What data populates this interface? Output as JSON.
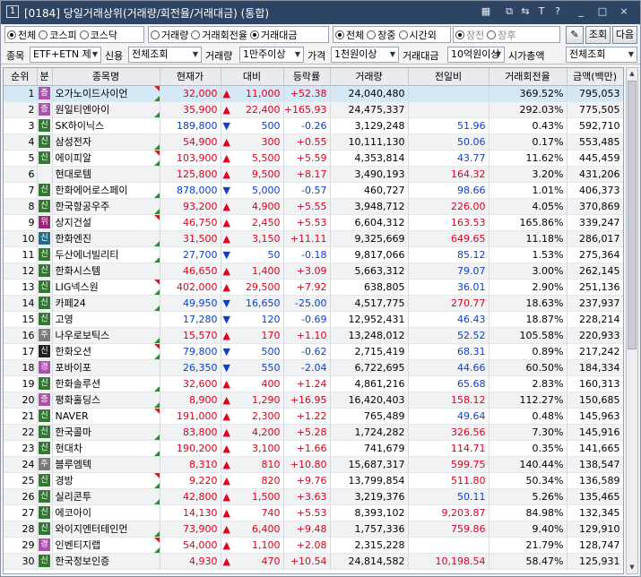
{
  "window": {
    "screen_no": "1",
    "title": "[0184] 당일거래상위(거래량/회전율/거래대금) (통합)",
    "title_icons": [
      "grid-icon",
      "copy-icon",
      "link-icon",
      "font-icon",
      "help-icon",
      "minimize-icon",
      "maximize-icon",
      "close-icon"
    ],
    "title_glyphs": [
      "▦",
      "⧉",
      "⇆",
      "T",
      "?",
      "_",
      "□",
      "×"
    ]
  },
  "filters": {
    "market": {
      "options": [
        "전체",
        "코스피",
        "코스닥"
      ],
      "selected": "전체"
    },
    "sort": {
      "options": [
        "거래량",
        "거래회전율",
        "거래대금"
      ],
      "selected": "거래대금"
    },
    "session": {
      "options": [
        "전체",
        "장중",
        "시간외"
      ],
      "selected": "전체"
    },
    "after_hours": {
      "options": [
        "장전",
        "장후"
      ],
      "selected": "장전"
    },
    "search_label": "조회",
    "next_label": "다음",
    "stock_label": "종목",
    "stock_value": "ETF+ETN 제",
    "credit_label": "신용",
    "credit_value": "전체조회",
    "volume_label": "거래량",
    "volume_value": "1만주이상",
    "price_label": "가격",
    "price_value": "1천원이상",
    "amount_label": "거래대금",
    "amount_value": "10억원이상",
    "mcap_label": "시가총액",
    "mcap_value": "전체조회"
  },
  "table": {
    "headers": [
      "순위",
      "분",
      "종목명",
      "현재가",
      "대비",
      "등락률",
      "거래량",
      "전일비",
      "거래회전율",
      "금액(백만)"
    ],
    "rows": [
      {
        "rank": "1",
        "badge": "증",
        "badge_color": "#b04fb0",
        "name": "오가노이드사이언",
        "price": "32,000",
        "dir": "up",
        "change": "11,000",
        "rate": "+52.38",
        "volume": "24,040,480",
        "prev": "",
        "turnover": "369.52%",
        "amount": "795,053"
      },
      {
        "rank": "2",
        "badge": "증",
        "badge_color": "#b04fb0",
        "name": "원일티엔아이",
        "price": "35,900",
        "dir": "up",
        "change": "22,400",
        "rate": "+165.93",
        "volume": "24,475,337",
        "prev": "",
        "turnover": "292.03%",
        "amount": "775,505"
      },
      {
        "rank": "3",
        "badge": "신",
        "badge_color": "#2f7a2f",
        "name": "SK하이닉스",
        "price": "189,800",
        "dir": "dn",
        "change": "500",
        "rate": "-0.26",
        "volume": "3,129,248",
        "prev": "51.96",
        "turnover": "0.43%",
        "amount": "592,710"
      },
      {
        "rank": "4",
        "badge": "신",
        "badge_color": "#2f7a2f",
        "name": "삼성전자",
        "price": "54,900",
        "dir": "up",
        "change": "300",
        "rate": "+0.55",
        "volume": "10,111,130",
        "prev": "50.06",
        "turnover": "0.17%",
        "amount": "553,485"
      },
      {
        "rank": "5",
        "badge": "신",
        "badge_color": "#2f7a2f",
        "name": "에이피알",
        "price": "103,900",
        "dir": "up",
        "change": "5,500",
        "rate": "+5.59",
        "volume": "4,353,814",
        "prev": "43.77",
        "turnover": "11.62%",
        "amount": "445,459"
      },
      {
        "rank": "6",
        "badge": "",
        "badge_color": "",
        "name": "현대로템",
        "price": "125,800",
        "dir": "up",
        "change": "9,500",
        "rate": "+8.17",
        "volume": "3,490,193",
        "prev": "164.32",
        "turnover": "3.20%",
        "amount": "431,206"
      },
      {
        "rank": "7",
        "badge": "신",
        "badge_color": "#2f7a2f",
        "name": "한화에어로스페이",
        "price": "878,000",
        "dir": "dn",
        "change": "5,000",
        "rate": "-0.57",
        "volume": "460,727",
        "prev": "98.66",
        "turnover": "1.01%",
        "amount": "406,373"
      },
      {
        "rank": "8",
        "badge": "신",
        "badge_color": "#2f7a2f",
        "name": "한국항공우주",
        "price": "93,200",
        "dir": "up",
        "change": "4,900",
        "rate": "+5.55",
        "volume": "3,948,712",
        "prev": "226.00",
        "turnover": "4.05%",
        "amount": "370,869"
      },
      {
        "rank": "9",
        "badge": "위",
        "badge_color": "#a0207a",
        "name": "상지건설",
        "price": "46,750",
        "dir": "up",
        "change": "2,450",
        "rate": "+5.53",
        "volume": "6,604,312",
        "prev": "163.53",
        "turnover": "165.86%",
        "amount": "339,247"
      },
      {
        "rank": "10",
        "badge": "신",
        "badge_color": "#1f6f8a",
        "name": "한화엔진",
        "price": "31,500",
        "dir": "up",
        "change": "3,150",
        "rate": "+11.11",
        "volume": "9,325,669",
        "prev": "649.65",
        "turnover": "11.18%",
        "amount": "286,017"
      },
      {
        "rank": "11",
        "badge": "신",
        "badge_color": "#2f7a2f",
        "name": "두산에너빌리티",
        "price": "27,700",
        "dir": "dn",
        "change": "50",
        "rate": "-0.18",
        "volume": "9,817,066",
        "prev": "85.12",
        "turnover": "1.53%",
        "amount": "275,364"
      },
      {
        "rank": "12",
        "badge": "신",
        "badge_color": "#2f7a2f",
        "name": "한화시스템",
        "price": "46,650",
        "dir": "up",
        "change": "1,400",
        "rate": "+3.09",
        "volume": "5,663,312",
        "prev": "79.07",
        "turnover": "3.00%",
        "amount": "262,145"
      },
      {
        "rank": "13",
        "badge": "신",
        "badge_color": "#2f7a2f",
        "name": "LIG넥스원",
        "price": "402,000",
        "dir": "up",
        "change": "29,500",
        "rate": "+7.92",
        "volume": "638,805",
        "prev": "36.01",
        "turnover": "2.90%",
        "amount": "251,136"
      },
      {
        "rank": "14",
        "badge": "신",
        "badge_color": "#2f7a2f",
        "name": "카페24",
        "price": "49,950",
        "dir": "dn",
        "change": "16,650",
        "rate": "-25.00",
        "volume": "4,517,775",
        "prev": "270.77",
        "turnover": "18.63%",
        "amount": "237,937"
      },
      {
        "rank": "15",
        "badge": "신",
        "badge_color": "#2f7a2f",
        "name": "고영",
        "price": "17,280",
        "dir": "dn",
        "change": "120",
        "rate": "-0.69",
        "volume": "12,952,431",
        "prev": "46.43",
        "turnover": "18.87%",
        "amount": "228,214"
      },
      {
        "rank": "16",
        "badge": "주",
        "badge_color": "#7a7a7a",
        "name": "나우로보틱스",
        "price": "15,570",
        "dir": "up",
        "change": "170",
        "rate": "+1.10",
        "volume": "13,248,012",
        "prev": "52.52",
        "turnover": "105.58%",
        "amount": "220,933"
      },
      {
        "rank": "17",
        "badge": "신",
        "badge_color": "#222222",
        "name": "한화오션",
        "price": "79,800",
        "dir": "dn",
        "change": "500",
        "rate": "-0.62",
        "volume": "2,715,419",
        "prev": "68.31",
        "turnover": "0.89%",
        "amount": "217,242"
      },
      {
        "rank": "18",
        "badge": "경",
        "badge_color": "#b04fb0",
        "name": "포바이포",
        "price": "26,350",
        "dir": "dn",
        "change": "550",
        "rate": "-2.04",
        "volume": "6,722,695",
        "prev": "44.66",
        "turnover": "60.50%",
        "amount": "184,334"
      },
      {
        "rank": "19",
        "badge": "신",
        "badge_color": "#2f7a2f",
        "name": "한화솔루션",
        "price": "32,600",
        "dir": "up",
        "change": "400",
        "rate": "+1.24",
        "volume": "4,861,216",
        "prev": "65.68",
        "turnover": "2.83%",
        "amount": "160,313"
      },
      {
        "rank": "20",
        "badge": "증",
        "badge_color": "#b04fb0",
        "name": "평화홀딩스",
        "price": "8,900",
        "dir": "up",
        "change": "1,290",
        "rate": "+16.95",
        "volume": "16,420,403",
        "prev": "158.12",
        "turnover": "112.27%",
        "amount": "150,685"
      },
      {
        "rank": "21",
        "badge": "신",
        "badge_color": "#2f7a2f",
        "name": "NAVER",
        "price": "191,000",
        "dir": "up",
        "change": "2,300",
        "rate": "+1.22",
        "volume": "765,489",
        "prev": "49.64",
        "turnover": "0.48%",
        "amount": "145,963"
      },
      {
        "rank": "22",
        "badge": "신",
        "badge_color": "#2f7a2f",
        "name": "한국콜마",
        "price": "83,800",
        "dir": "up",
        "change": "4,200",
        "rate": "+5.28",
        "volume": "1,724,282",
        "prev": "326.56",
        "turnover": "7.30%",
        "amount": "145,916"
      },
      {
        "rank": "23",
        "badge": "신",
        "badge_color": "#2f7a2f",
        "name": "현대차",
        "price": "190,200",
        "dir": "up",
        "change": "3,100",
        "rate": "+1.66",
        "volume": "741,679",
        "prev": "114.71",
        "turnover": "0.35%",
        "amount": "141,665"
      },
      {
        "rank": "24",
        "badge": "주",
        "badge_color": "#7a7a7a",
        "name": "블루엠텍",
        "price": "8,310",
        "dir": "up",
        "change": "810",
        "rate": "+10.80",
        "volume": "15,687,317",
        "prev": "599.75",
        "turnover": "140.44%",
        "amount": "138,547"
      },
      {
        "rank": "25",
        "badge": "신",
        "badge_color": "#2f7a2f",
        "name": "경방",
        "price": "9,220",
        "dir": "up",
        "change": "820",
        "rate": "+9.76",
        "volume": "13,799,854",
        "prev": "511.80",
        "turnover": "50.34%",
        "amount": "136,589"
      },
      {
        "rank": "26",
        "badge": "신",
        "badge_color": "#2f7a2f",
        "name": "실리콘투",
        "price": "42,800",
        "dir": "up",
        "change": "1,500",
        "rate": "+3.63",
        "volume": "3,219,376",
        "prev": "50.11",
        "turnover": "5.26%",
        "amount": "135,465"
      },
      {
        "rank": "27",
        "badge": "신",
        "badge_color": "#2f7a2f",
        "name": "에코아이",
        "price": "14,130",
        "dir": "up",
        "change": "740",
        "rate": "+5.53",
        "volume": "8,393,102",
        "prev": "9,203.87",
        "turnover": "84.98%",
        "amount": "132,345"
      },
      {
        "rank": "28",
        "badge": "신",
        "badge_color": "#2f7a2f",
        "name": "와이지엔터테인먼",
        "price": "73,900",
        "dir": "up",
        "change": "6,400",
        "rate": "+9.48",
        "volume": "1,757,336",
        "prev": "759.86",
        "turnover": "9.40%",
        "amount": "129,910"
      },
      {
        "rank": "29",
        "badge": "경",
        "badge_color": "#b04fb0",
        "name": "인벤티지랩",
        "price": "54,000",
        "dir": "up",
        "change": "1,100",
        "rate": "+2.08",
        "volume": "2,315,228",
        "prev": "",
        "turnover": "21.79%",
        "amount": "128,747"
      },
      {
        "rank": "30",
        "badge": "신",
        "badge_color": "#2f7a2f",
        "name": "한국정보인증",
        "price": "4,930",
        "dir": "up",
        "change": "470",
        "rate": "+10.54",
        "volume": "24,814,582",
        "prev": "10,198.54",
        "turnover": "58.47%",
        "amount": "125,931"
      }
    ]
  },
  "colors": {
    "up": "#e0001a",
    "down": "#0a3fd1",
    "title_bg": "#2e4463",
    "selected_row": "#d5e8f6"
  }
}
